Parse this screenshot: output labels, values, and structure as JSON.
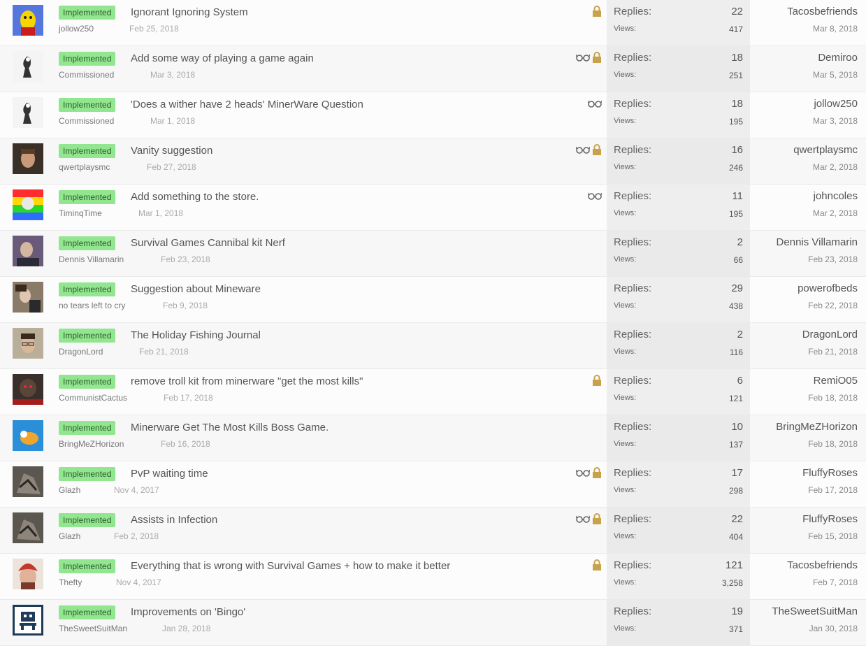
{
  "colors": {
    "badge_bg": "#92e68f",
    "badge_text": "#2a5a2a",
    "stats_bg": "#eeeeee",
    "lock_color": "#c8a24a",
    "glasses_color": "#666666"
  },
  "threads": [
    {
      "prefix": "Implemented",
      "title": "Ignorant Ignoring System",
      "author": "jollow250",
      "start_date": "Feb 25, 2018",
      "icons": [
        "lock-icon"
      ],
      "replies_label": "Replies:",
      "replies": "22",
      "views_label": "Views:",
      "views": "417",
      "last_user": "Tacosbefriends",
      "last_date": "Mar 8, 2018",
      "avatar": "yellow-bird-avatar"
    },
    {
      "prefix": "Implemented",
      "title": "Add some way of playing a game again",
      "author": "Commissioned",
      "start_date": "Mar 3, 2018",
      "icons": [
        "watch-glasses-icon",
        "lock-icon"
      ],
      "replies_label": "Replies:",
      "replies": "18",
      "views_label": "Views:",
      "views": "251",
      "last_user": "Demiroo",
      "last_date": "Mar 5, 2018",
      "avatar": "sketch-figure-avatar"
    },
    {
      "prefix": "Implemented",
      "title": "'Does a wither have 2 heads' MinerWare Question",
      "author": "Commissioned",
      "start_date": "Mar 1, 2018",
      "icons": [
        "watch-glasses-icon"
      ],
      "replies_label": "Replies:",
      "replies": "18",
      "views_label": "Views:",
      "views": "195",
      "last_user": "jollow250",
      "last_date": "Mar 3, 2018",
      "avatar": "sketch-figure-avatar"
    },
    {
      "prefix": "Implemented",
      "title": "Vanity suggestion",
      "author": "qwertplaysmc",
      "start_date": "Feb 27, 2018",
      "icons": [
        "watch-glasses-icon",
        "lock-icon"
      ],
      "replies_label": "Replies:",
      "replies": "16",
      "views_label": "Views:",
      "views": "246",
      "last_user": "qwertplaysmc",
      "last_date": "Mar 2, 2018",
      "avatar": "person-face-avatar"
    },
    {
      "prefix": "Implemented",
      "title": "Add something to the store.",
      "author": "TiminqTime",
      "start_date": "Mar 1, 2018",
      "icons": [
        "watch-glasses-icon"
      ],
      "replies_label": "Replies:",
      "replies": "11",
      "views_label": "Views:",
      "views": "195",
      "last_user": "johncoles",
      "last_date": "Mar 2, 2018",
      "avatar": "rainbow-avatar"
    },
    {
      "prefix": "Implemented",
      "title": "Survival Games Cannibal kit Nerf",
      "author": "Dennis Villamarin",
      "start_date": "Feb 23, 2018",
      "icons": [],
      "replies_label": "Replies:",
      "replies": "2",
      "views_label": "Views:",
      "views": "66",
      "last_user": "Dennis Villamarin",
      "last_date": "Feb 23, 2018",
      "avatar": "purple-person-avatar"
    },
    {
      "prefix": "Implemented",
      "title": "Suggestion about Mineware",
      "author": "no tears left to cry",
      "start_date": "Feb 9, 2018",
      "icons": [],
      "replies_label": "Replies:",
      "replies": "29",
      "views_label": "Views:",
      "views": "438",
      "last_user": "powerofbeds",
      "last_date": "Feb 22, 2018",
      "avatar": "brown-person-avatar"
    },
    {
      "prefix": "Implemented",
      "title": "The Holiday Fishing Journal",
      "author": "DragonLord",
      "start_date": "Feb 21, 2018",
      "icons": [],
      "replies_label": "Replies:",
      "replies": "2",
      "views_label": "Views:",
      "views": "116",
      "last_user": "DragonLord",
      "last_date": "Feb 21, 2018",
      "avatar": "glasses-person-avatar"
    },
    {
      "prefix": "Implemented",
      "title": "remove troll kit from minerware \"get the most kills\"",
      "author": "CommunistCactus",
      "start_date": "Feb 17, 2018",
      "icons": [
        "lock-icon"
      ],
      "replies_label": "Replies:",
      "replies": "6",
      "views_label": "Views:",
      "views": "121",
      "last_user": "RemiO05",
      "last_date": "Feb 18, 2018",
      "avatar": "dark-creature-avatar"
    },
    {
      "prefix": "Implemented",
      "title": "Minerware Get The Most Kills Boss Game.",
      "author": "BringMeZHorizon",
      "start_date": "Feb 16, 2018",
      "icons": [],
      "replies_label": "Replies:",
      "replies": "10",
      "views_label": "Views:",
      "views": "137",
      "last_user": "BringMeZHorizon",
      "last_date": "Feb 18, 2018",
      "avatar": "blue-orange-avatar"
    },
    {
      "prefix": "Implemented",
      "title": "PvP waiting time",
      "author": "Glazh",
      "start_date": "Nov 4, 2017",
      "icons": [
        "watch-glasses-icon",
        "lock-icon"
      ],
      "replies_label": "Replies:",
      "replies": "17",
      "views_label": "Views:",
      "views": "298",
      "last_user": "FluffyRoses",
      "last_date": "Feb 17, 2018",
      "avatar": "grey-cat-avatar"
    },
    {
      "prefix": "Implemented",
      "title": "Assists in Infection",
      "author": "Glazh",
      "start_date": "Feb 2, 2018",
      "icons": [
        "watch-glasses-icon",
        "lock-icon"
      ],
      "replies_label": "Replies:",
      "replies": "22",
      "views_label": "Views:",
      "views": "404",
      "last_user": "FluffyRoses",
      "last_date": "Feb 15, 2018",
      "avatar": "grey-cat-avatar"
    },
    {
      "prefix": "Implemented",
      "title": "Everything that is wrong with Survival Games + how to make it better",
      "author": "Thefty",
      "start_date": "Nov 4, 2017",
      "icons": [
        "lock-icon"
      ],
      "replies_label": "Replies:",
      "replies": "121",
      "views_label": "Views:",
      "views": "3,258",
      "last_user": "Tacosbefriends",
      "last_date": "Feb 7, 2018",
      "avatar": "red-hair-avatar"
    },
    {
      "prefix": "Implemented",
      "title": "Improvements on 'Bingo'",
      "author": "TheSweetSuitMan",
      "start_date": "Jan 28, 2018",
      "icons": [],
      "replies_label": "Replies:",
      "replies": "19",
      "views_label": "Views:",
      "views": "371",
      "last_user": "TheSweetSuitMan",
      "last_date": "Jan 30, 2018",
      "avatar": "pixel-robot-avatar"
    }
  ]
}
